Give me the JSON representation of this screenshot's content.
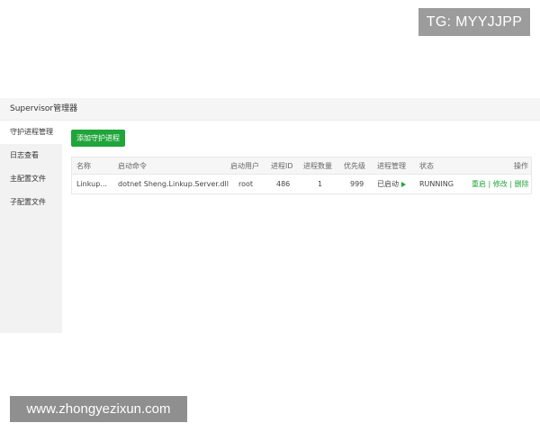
{
  "overlay": {
    "tg_badge": "TG: MYYJJPP",
    "watermark": "www.zhongyezixun.com"
  },
  "header": {
    "title": "Supervisor管理器"
  },
  "sidebar": {
    "items": [
      {
        "label": "守护进程管理",
        "active": true
      },
      {
        "label": "日志查看",
        "active": false
      },
      {
        "label": "主配置文件",
        "active": false
      },
      {
        "label": "子配置文件",
        "active": false
      }
    ]
  },
  "toolbar": {
    "add_label": "添加守护进程"
  },
  "table": {
    "columns": {
      "name": "名称",
      "command": "启动命令",
      "user": "启动用户",
      "pid": "进程ID",
      "count": "进程数量",
      "priority": "优先级",
      "manage": "进程管理",
      "state": "状态",
      "ops": "操作"
    },
    "rows": [
      {
        "name": "Linkup...",
        "command": "dotnet Sheng.Linkup.Server.dll",
        "user": "root",
        "pid": "486",
        "count": "1",
        "priority": "999",
        "manage": "已启动",
        "state": "RUNNING",
        "ops": {
          "restart": "重启",
          "edit": "修改",
          "delete": "删除",
          "separator": "|"
        }
      }
    ]
  },
  "colors": {
    "accent": "#20a53a"
  },
  "icons": {
    "manage_status": "play-icon"
  }
}
